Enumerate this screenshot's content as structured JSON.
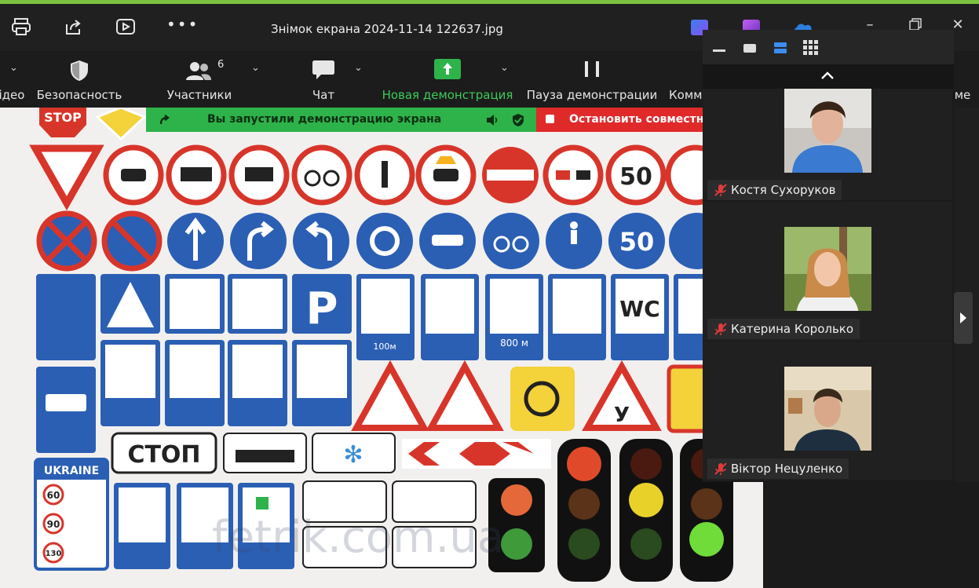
{
  "window": {
    "title": "Знімок екрана 2024-11-14 122637.jpg"
  },
  "toolbar": {
    "video_label": "ідео",
    "security_label": "Безопасность",
    "participants_label": "Участники",
    "participants_count": "6",
    "chat_label": "Чат",
    "new_share_label": "Новая демонстрация",
    "pause_share_label": "Пауза демонстрации",
    "more_label_partial": "Комм",
    "right_partial": "ме"
  },
  "banner": {
    "sharing_text": "Вы запустили демонстрацию экрана",
    "stop_text": "Остановить совместно"
  },
  "participants": [
    {
      "name": "Костя Сухоруков",
      "muted": true
    },
    {
      "name": "Катерина Королько",
      "muted": true
    },
    {
      "name": "Віктор Нецуленко",
      "muted": true
    }
  ],
  "shared_image": {
    "signs_text": {
      "stop_top": "STOP",
      "speed": "50",
      "speed2": "50",
      "distance1": "100м",
      "distance2": "800 м",
      "wc": "WC",
      "ukraine": "UKRAINE",
      "limit60": "60",
      "limit90": "90",
      "limit130": "130",
      "stop_cyr": "СТОП",
      "y_letter": "У",
      "watermark": "fetrik.com.ua"
    }
  },
  "colors": {
    "accent_green": "#2db34a",
    "stop_red": "#e02a2a",
    "top_strip": "#7cc142"
  }
}
